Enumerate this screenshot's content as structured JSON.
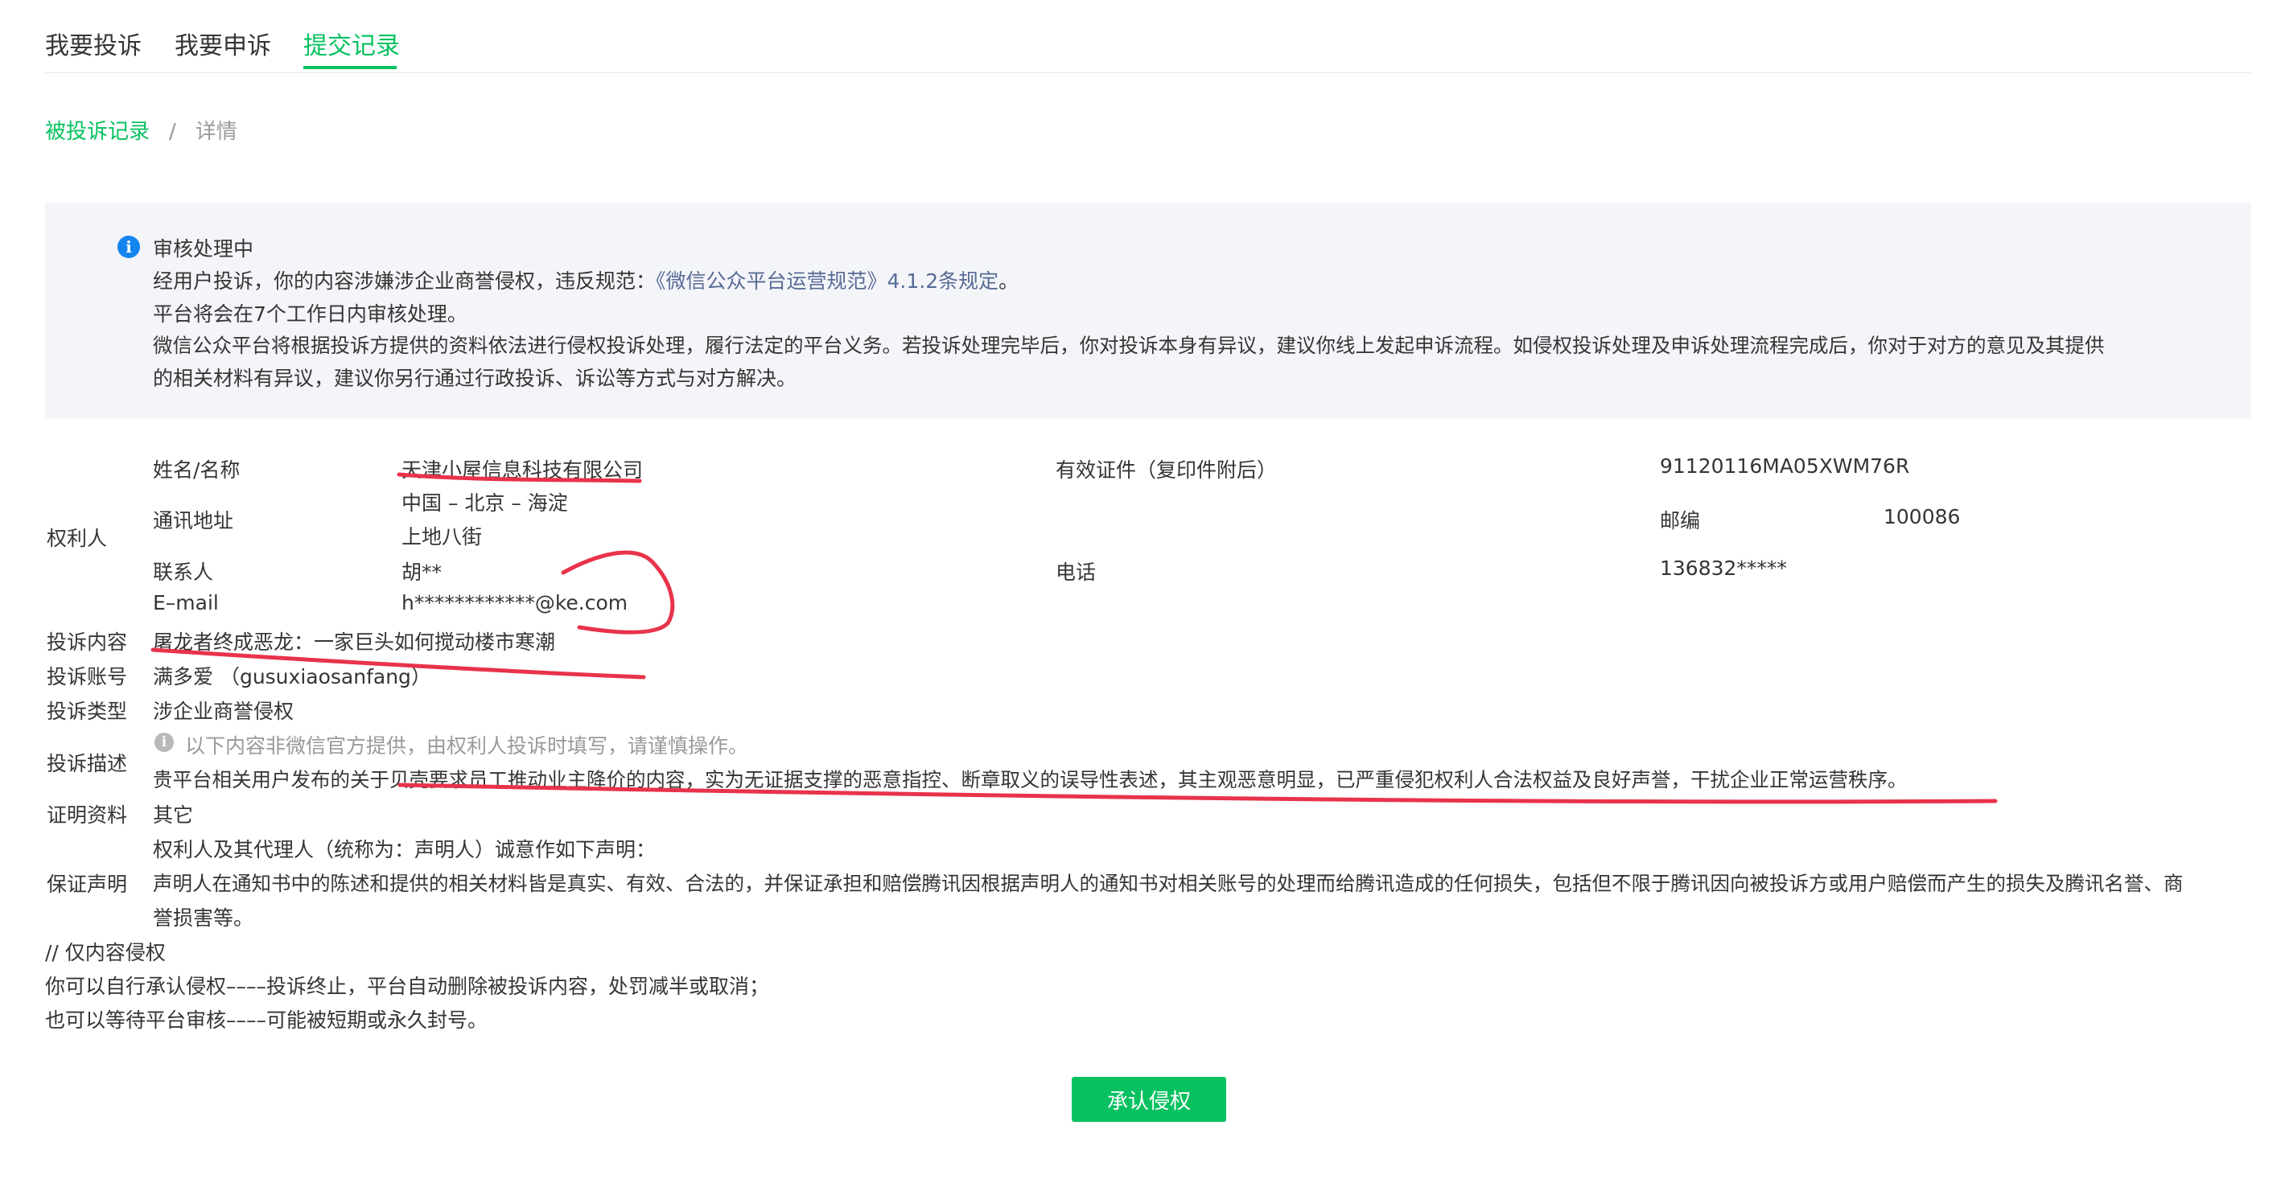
{
  "tabs": [
    {
      "label": "我要投诉",
      "active": false
    },
    {
      "label": "我要申诉",
      "active": false
    },
    {
      "label": "提交记录",
      "active": true
    }
  ],
  "breadcrumb": {
    "link": "被投诉记录",
    "separator": "/",
    "current": "详情"
  },
  "notice": {
    "title": "审核处理中",
    "line1_prefix": "经用户投诉，你的内容涉嫌涉企业商誉侵权，违反规范：",
    "line1_link": "《微信公众平台运营规范》4.1.2条规定",
    "line1_suffix": "。",
    "line2": "平台将会在7个工作日内审核处理。",
    "line3": "微信公众平台将根据投诉方提供的资料依法进行侵权投诉处理，履行法定的平台义务。若投诉处理完毕后，你对投诉本身有异议，建议你线上发起申诉流程。如侵权投诉处理及申诉处理流程完成后，你对于对方的意见及其提供",
    "line4": "的相关材料有异议，建议你另行通过行政投诉、诉讼等方式与对方解决。"
  },
  "rights_holder": {
    "section_label": "权利人",
    "name_label": "姓名/名称",
    "name_value": "天津小屋信息科技有限公司",
    "cert_label": "有效证件（复印件附后）",
    "cert_value": "91120116MA05XWM76R",
    "address_label": "通讯地址",
    "address_line1": "中国 – 北京 – 海淀",
    "address_line2": "上地八街",
    "postcode_label": "邮编",
    "postcode_value": "100086",
    "contact_label": "联系人",
    "contact_value": "胡**",
    "phone_label": "电话",
    "phone_value": "136832*****",
    "email_label": "E–mail",
    "email_value": "h************@ke.com"
  },
  "complaint": {
    "content_label": "投诉内容",
    "content_value": "屠龙者终成恶龙：一家巨头如何搅动楼市寒潮",
    "account_label": "投诉账号",
    "account_value": "满多爱 （gusuxiaosanfang）",
    "type_label": "投诉类型",
    "type_value": "涉企业商誉侵权",
    "desc_label": "投诉描述",
    "desc_hint": "以下内容非微信官方提供，由权利人投诉时填写，请谨慎操作。",
    "desc_value": "贵平台相关用户发布的关于贝壳要求员工推动业主降价的内容，实为无证据支撑的恶意指控、断章取义的误导性表述，其主观恶意明显，已严重侵犯权利人合法权益及良好声誉，干扰企业正常运营秩序。",
    "evidence_label": "证明资料",
    "evidence_value": "其它",
    "guarantee_label": "保证声明",
    "guarantee_line1": "权利人及其代理人（统称为：声明人）诚意作如下声明：",
    "guarantee_line2": "声明人在通知书中的陈述和提供的相关材料皆是真实、有效、合法的，并保证承担和赔偿腾讯因根据声明人的通知书对相关账号的处理而给腾讯造成的任何损失，包括但不限于腾讯因向被投诉方或用户赔偿而产生的损失及腾讯名誉、商",
    "guarantee_line3": "誉损害等。"
  },
  "footer_notes": {
    "line1": "// 仅内容侵权",
    "line2": "你可以自行承认侵权––––投诉终止，平台自动删除被投诉内容，处罚减半或取消；",
    "line3": "也可以等待平台审核––––可能被短期或永久封号。"
  },
  "actions": {
    "confirm_label": "承认侵权"
  },
  "colors": {
    "accent": "#07c160",
    "link": "#576b95",
    "info": "#1485ee",
    "annotation": "#e8334a"
  },
  "icons": {
    "notice": "info-icon",
    "hint": "info-icon"
  }
}
